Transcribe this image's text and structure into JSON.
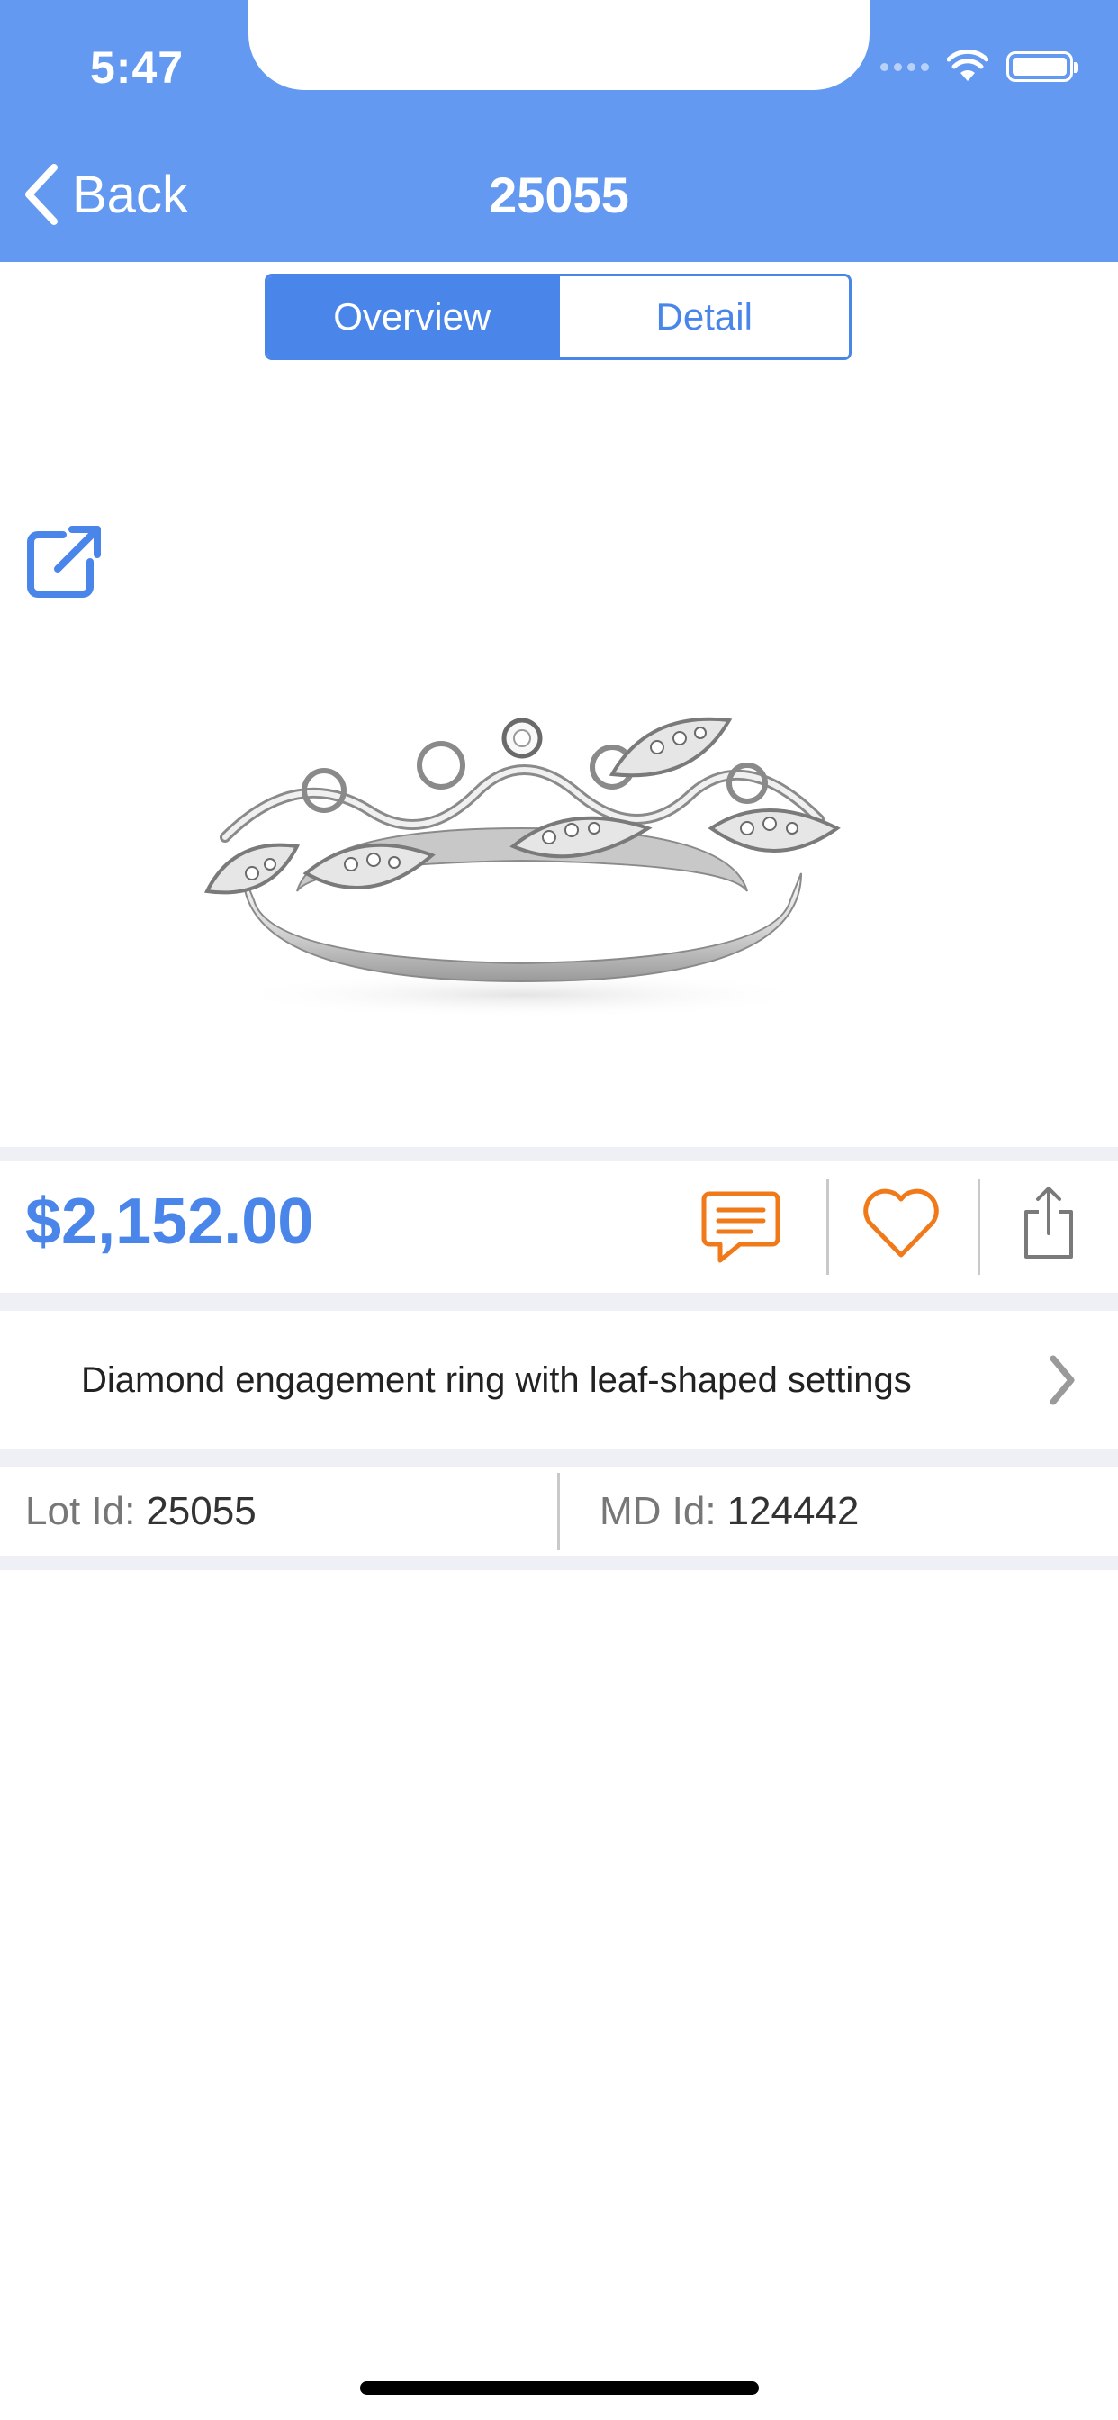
{
  "status_bar": {
    "time": "5:47"
  },
  "nav": {
    "back_label": "Back",
    "title": "25055"
  },
  "tabs": [
    {
      "label": "Overview",
      "active": true
    },
    {
      "label": "Detail",
      "active": false
    }
  ],
  "product": {
    "price": "$2,152.00",
    "description": "Diamond engagement ring with leaf-shaped settings",
    "lot_id_label": "Lot Id:",
    "lot_id_value": "25055",
    "md_id_label": "MD Id:",
    "md_id_value": "124442"
  },
  "icons": {
    "external_link": "external-link-icon",
    "chat": "chat-icon",
    "favorite": "heart-icon",
    "share": "share-icon",
    "chevron": "chevron-right-icon"
  },
  "colors": {
    "header": "#6399F0",
    "accent": "#4A85EA",
    "action_orange": "#F07A1A",
    "divider": "#EEF0F5"
  }
}
